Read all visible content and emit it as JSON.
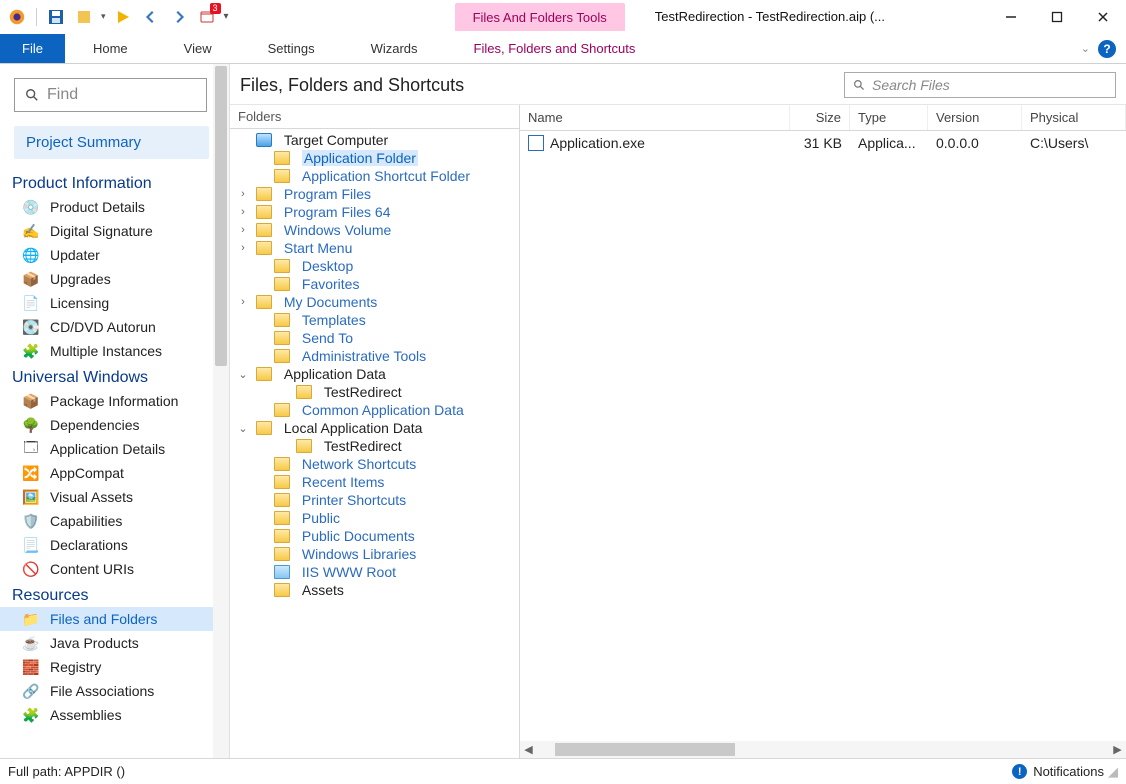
{
  "window": {
    "title": "TestRedirection - TestRedirection.aip (...",
    "context_tab": "Files And Folders Tools"
  },
  "ribbon": {
    "file": "File",
    "tabs": [
      "Home",
      "View",
      "Settings",
      "Wizards"
    ],
    "context_tab": "Files, Folders and Shortcuts"
  },
  "left": {
    "find_placeholder": "Find",
    "project_summary": "Project Summary",
    "sections": {
      "product_info": {
        "title": "Product Information",
        "items": [
          "Product Details",
          "Digital Signature",
          "Updater",
          "Upgrades",
          "Licensing",
          "CD/DVD Autorun",
          "Multiple Instances"
        ]
      },
      "uwp": {
        "title": "Universal Windows",
        "items": [
          "Package Information",
          "Dependencies",
          "Application Details",
          "AppCompat",
          "Visual Assets",
          "Capabilities",
          "Declarations",
          "Content URIs"
        ]
      },
      "resources": {
        "title": "Resources",
        "items": [
          "Files and Folders",
          "Java Products",
          "Registry",
          "File Associations",
          "Assemblies"
        ]
      }
    }
  },
  "center": {
    "heading": "Files, Folders and Shortcuts",
    "search_placeholder": "Search Files",
    "folders_label": "Folders",
    "tree": {
      "root": "Target Computer",
      "app_folder": "Application Folder",
      "nodes": [
        {
          "label": "Application Shortcut Folder"
        },
        {
          "label": "Program Files",
          "exp": ">"
        },
        {
          "label": "Program Files 64",
          "exp": ">"
        },
        {
          "label": "Windows Volume",
          "exp": ">"
        },
        {
          "label": "Start Menu",
          "exp": ">"
        },
        {
          "label": "Desktop"
        },
        {
          "label": "Favorites"
        },
        {
          "label": "My Documents",
          "exp": ">"
        },
        {
          "label": "Templates"
        },
        {
          "label": "Send To"
        },
        {
          "label": "Administrative Tools"
        }
      ],
      "app_data": "Application Data",
      "app_data_child": "TestRedirect",
      "common_app_data": "Common Application Data",
      "local_app_data": "Local Application Data",
      "local_app_data_child": "TestRedirect",
      "tail": [
        "Network Shortcuts",
        "Recent Items",
        "Printer Shortcuts",
        "Public",
        "Public Documents",
        "Windows Libraries",
        "IIS WWW Root",
        "Assets"
      ]
    },
    "list": {
      "columns": {
        "name": "Name",
        "size": "Size",
        "type": "Type",
        "version": "Version",
        "physical": "Physical "
      },
      "rows": [
        {
          "name": "Application.exe",
          "size": "31 KB",
          "type": "Applica...",
          "version": "0.0.0.0",
          "physical": "C:\\Users\\"
        }
      ]
    }
  },
  "status": {
    "path": "Full path: APPDIR ()",
    "notifications": "Notifications"
  }
}
